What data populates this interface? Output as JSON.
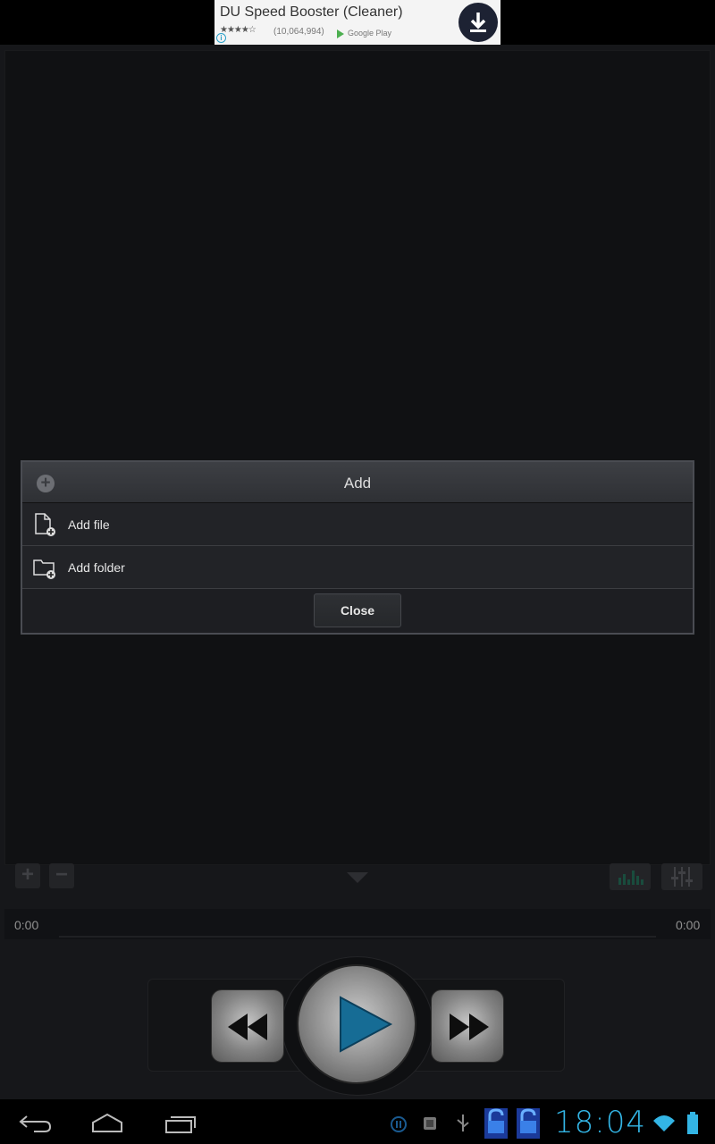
{
  "ad": {
    "title": "DU Speed Booster (Cleaner)",
    "rating_count": "(10,064,994)",
    "store": "Google Play",
    "stars": "★★★★☆"
  },
  "player": {
    "elapsed": "0:00",
    "duration": "0:00",
    "progress": 0
  },
  "dialog": {
    "title": "Add",
    "items": [
      {
        "label": "Add file",
        "icon": "file-add-icon"
      },
      {
        "label": "Add folder",
        "icon": "folder-add-icon"
      }
    ],
    "close_label": "Close"
  },
  "status": {
    "time": "18:04"
  },
  "colors": {
    "accent": "#33b5e5",
    "play": "#1a7fb0",
    "background": "#131417"
  }
}
